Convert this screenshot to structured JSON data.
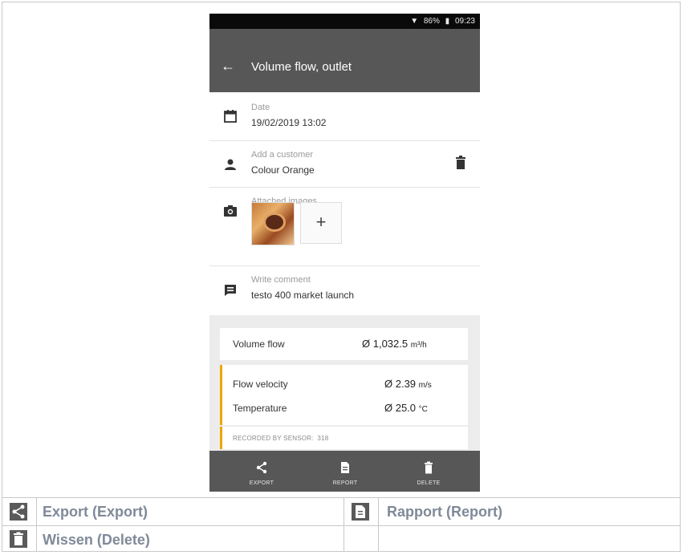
{
  "status_bar": {
    "battery": "86%",
    "time": "09:23"
  },
  "app_bar": {
    "title": "Volume flow, outlet"
  },
  "details": {
    "date": {
      "label": "Date",
      "value": "19/02/2019 13:02"
    },
    "customer": {
      "label": "Add a customer",
      "value": "Colour Orange"
    },
    "images": {
      "label": "Attached images",
      "add": "+"
    },
    "comment": {
      "label": "Write comment",
      "value": "testo 400 market launch"
    }
  },
  "measurements": {
    "volume_flow": {
      "label": "Volume flow",
      "value": "Ø 1,032.5",
      "unit": "m³/h"
    },
    "flow_velocity": {
      "label": "Flow velocity",
      "value": "Ø 2.39",
      "unit": "m/s"
    },
    "temperature": {
      "label": "Temperature",
      "value": "Ø 25.0",
      "unit": "°C"
    },
    "sensor": {
      "label": "RECORDED BY SENSOR:",
      "value": "318"
    }
  },
  "bottom_bar": {
    "export": "EXPORT",
    "report": "REPORT",
    "delete": "DELETE"
  },
  "legend": {
    "export": "Export (Export)",
    "report": "Rapport (Report)",
    "delete": "Wissen (Delete)"
  },
  "colors": {
    "app_bar": "#575757",
    "accent": "#f0a500",
    "legend_text": "#7f8a99"
  }
}
